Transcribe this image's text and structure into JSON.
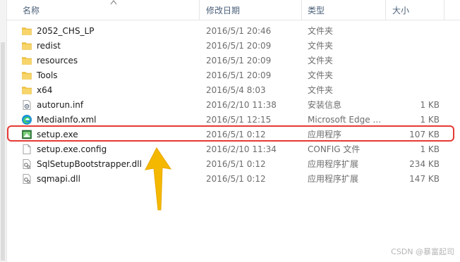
{
  "header": {
    "col_name": "名称",
    "col_date": "修改日期",
    "col_type": "类型",
    "col_size": "大小"
  },
  "files": [
    {
      "name": "2052_CHS_LP",
      "date": "2016/5/1 20:46",
      "type": "文件夹",
      "size": "",
      "icon": "folder-icon"
    },
    {
      "name": "redist",
      "date": "2016/5/1 20:09",
      "type": "文件夹",
      "size": "",
      "icon": "folder-icon"
    },
    {
      "name": "resources",
      "date": "2016/5/1 20:09",
      "type": "文件夹",
      "size": "",
      "icon": "folder-icon"
    },
    {
      "name": "Tools",
      "date": "2016/5/1 20:09",
      "type": "文件夹",
      "size": "",
      "icon": "folder-icon"
    },
    {
      "name": "x64",
      "date": "2016/5/4 8:03",
      "type": "文件夹",
      "size": "",
      "icon": "folder-icon"
    },
    {
      "name": "autorun.inf",
      "date": "2016/2/10 11:38",
      "type": "安装信息",
      "size": "1 KB",
      "icon": "settings-file-icon"
    },
    {
      "name": "MediaInfo.xml",
      "date": "2016/5/1 12:15",
      "type": "Microsoft Edge ...",
      "size": "1 KB",
      "icon": "edge-icon"
    },
    {
      "name": "setup.exe",
      "date": "2016/5/1 0:12",
      "type": "应用程序",
      "size": "107 KB",
      "icon": "setup-exe-icon"
    },
    {
      "name": "setup.exe.config",
      "date": "2016/2/10 11:34",
      "type": "CONFIG 文件",
      "size": "1 KB",
      "icon": "blank-file-icon"
    },
    {
      "name": "SqlSetupBootstrapper.dll",
      "date": "2016/5/1 0:12",
      "type": "应用程序扩展",
      "size": "234 KB",
      "icon": "dll-icon"
    },
    {
      "name": "sqmapi.dll",
      "date": "2016/5/1 0:12",
      "type": "应用程序扩展",
      "size": "147 KB",
      "icon": "dll-icon"
    }
  ],
  "highlighted_file": "setup.exe",
  "colors": {
    "highlight_border": "#e53935",
    "arrow": "#f5b800",
    "folder": "#f2c744"
  },
  "watermark": "CSDN @暴富起司"
}
